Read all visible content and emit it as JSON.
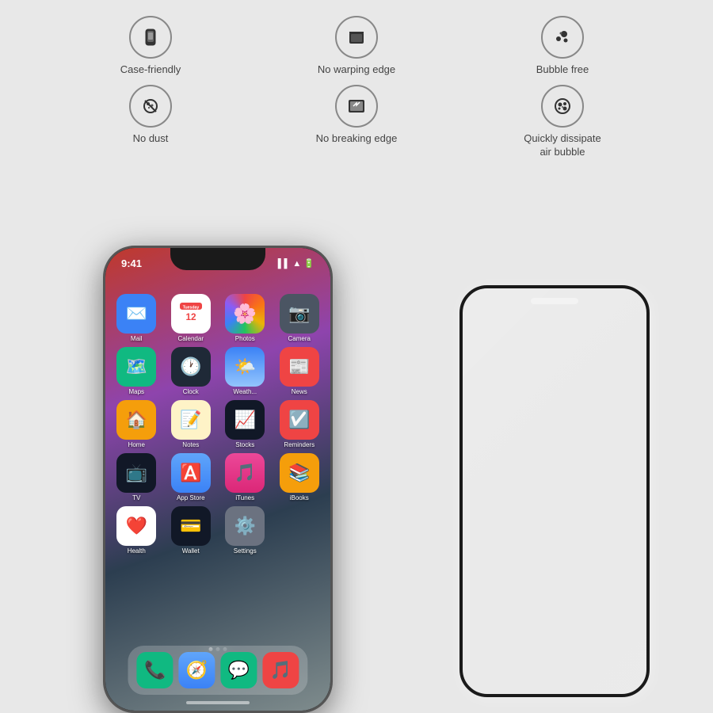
{
  "features": [
    {
      "id": "case-friendly",
      "label": "Case-friendly",
      "icon": "case"
    },
    {
      "id": "no-warping-edge",
      "label": "No warping edge",
      "icon": "no-warp"
    },
    {
      "id": "bubble-free",
      "label": "Bubble free",
      "icon": "bubble"
    },
    {
      "id": "no-dust",
      "label": "No dust",
      "icon": "dust"
    },
    {
      "id": "no-breaking-edge",
      "label": "No breaking edge",
      "icon": "break"
    },
    {
      "id": "quickly-dissipate",
      "label": "Quickly dissipate\nair bubble",
      "icon": "dissipate"
    }
  ],
  "phone": {
    "time": "9:41",
    "apps": [
      {
        "name": "Mail",
        "color": "#3b82f6",
        "emoji": "✉️"
      },
      {
        "name": "Calendar",
        "color": "#ef4444",
        "emoji": "📅"
      },
      {
        "name": "Photos",
        "color": "#f59e0b",
        "emoji": "📷"
      },
      {
        "name": "Camera",
        "color": "#6b7280",
        "emoji": "📸"
      },
      {
        "name": "Maps",
        "color": "#10b981",
        "emoji": "🗺️"
      },
      {
        "name": "Clock",
        "color": "#1f2937",
        "emoji": "🕐"
      },
      {
        "name": "Weather",
        "color": "#3b82f6",
        "emoji": "🌤️"
      },
      {
        "name": "News",
        "color": "#ef4444",
        "emoji": "📰"
      },
      {
        "name": "Home",
        "color": "#f59e0b",
        "emoji": "🏠"
      },
      {
        "name": "Notes",
        "color": "#fef3c7",
        "emoji": "📝"
      },
      {
        "name": "Stocks",
        "color": "#111827",
        "emoji": "📈"
      },
      {
        "name": "Reminders",
        "color": "#ef4444",
        "emoji": "☑️"
      },
      {
        "name": "TV",
        "color": "#111827",
        "emoji": "📺"
      },
      {
        "name": "App Store",
        "color": "#3b82f6",
        "emoji": "🅰️"
      },
      {
        "name": "iTunes",
        "color": "#ec4899",
        "emoji": "🎵"
      },
      {
        "name": "iBooks",
        "color": "#f59e0b",
        "emoji": "📚"
      },
      {
        "name": "Health",
        "color": "#ef4444",
        "emoji": "❤️"
      },
      {
        "name": "Wallet",
        "color": "#111827",
        "emoji": "💳"
      },
      {
        "name": "Settings",
        "color": "#6b7280",
        "emoji": "⚙️"
      }
    ],
    "dock": [
      {
        "name": "Phone",
        "color": "#10b981",
        "emoji": "📞"
      },
      {
        "name": "Safari",
        "color": "#3b82f6",
        "emoji": "🧭"
      },
      {
        "name": "Messages",
        "color": "#10b981",
        "emoji": "💬"
      },
      {
        "name": "Music",
        "color": "#ef4444",
        "emoji": "🎵"
      }
    ]
  }
}
